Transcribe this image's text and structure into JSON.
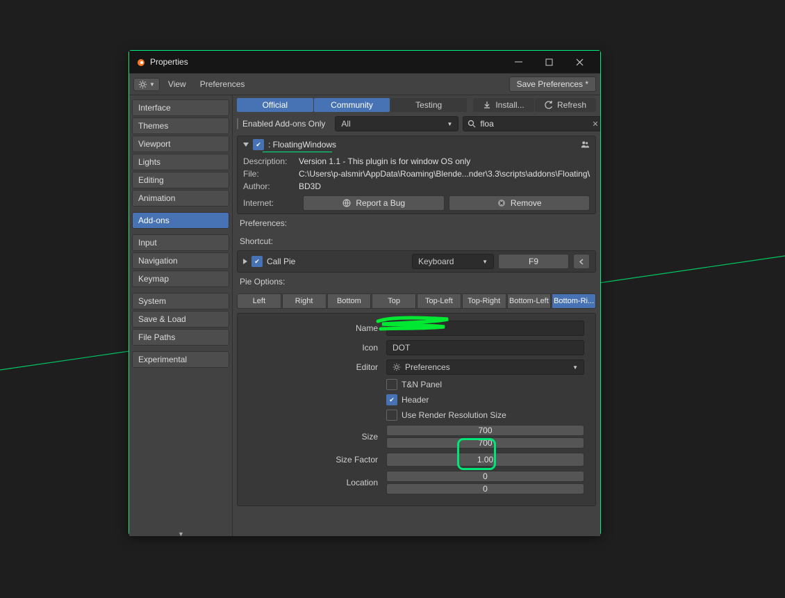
{
  "window": {
    "title": "Properties"
  },
  "menubar": {
    "gear": "⚙",
    "view": "View",
    "prefs": "Preferences",
    "save": "Save Preferences *"
  },
  "sidebar": {
    "groups": [
      [
        "Interface",
        "Themes",
        "Viewport",
        "Lights",
        "Editing",
        "Animation"
      ],
      [
        "Add-ons"
      ],
      [
        "Input",
        "Navigation",
        "Keymap"
      ],
      [
        "System",
        "Save & Load",
        "File Paths"
      ],
      [
        "Experimental"
      ]
    ],
    "active": "Add-ons"
  },
  "tabs": {
    "official": "Official",
    "community": "Community",
    "testing": "Testing",
    "install": "Install...",
    "refresh": "Refresh"
  },
  "filter": {
    "enabled_only": "Enabled Add-ons Only",
    "enabled_only_checked": false,
    "category": "All",
    "search": "floa"
  },
  "addon": {
    "name": ": FloatingWindows",
    "checked": true,
    "desc_label": "Description:",
    "desc": "Version 1.1 - This plugin is for window OS only",
    "file_label": "File:",
    "file": "C:\\Users\\p-alsmir\\AppData\\Roaming\\Blende...nder\\3.3\\scripts\\addons\\FloatingWindows.p",
    "author_label": "Author:",
    "author": "BD3D",
    "internet_label": "Internet:",
    "report": "Report a Bug",
    "remove": "Remove"
  },
  "labels": {
    "prefs": "Preferences:",
    "shortcut": "Shortcut:",
    "callpie": "Call Pie",
    "keyboard": "Keyboard",
    "key": "F9",
    "pie": "Pie Options:"
  },
  "pie_tabs": [
    "Left",
    "Right",
    "Bottom",
    "Top",
    "Top-Left",
    "Top-Right",
    "Bottom-Left",
    "Bottom-Ri..."
  ],
  "pie_active": "Bottom-Ri...",
  "form": {
    "name_label": "Name",
    "name_value": "",
    "icon_label": "Icon",
    "icon_value": "DOT",
    "editor_label": "Editor",
    "editor_value": "Preferences",
    "tn": "T&N Panel",
    "tn_checked": false,
    "header": "Header",
    "header_checked": true,
    "urs": "Use Render Resolution Size",
    "urs_checked": false,
    "size_label": "Size",
    "size_x": "700",
    "size_y": "700",
    "sf_label": "Size Factor",
    "sf": "1.00",
    "loc_label": "Location",
    "loc_x": "0",
    "loc_y": "0"
  }
}
